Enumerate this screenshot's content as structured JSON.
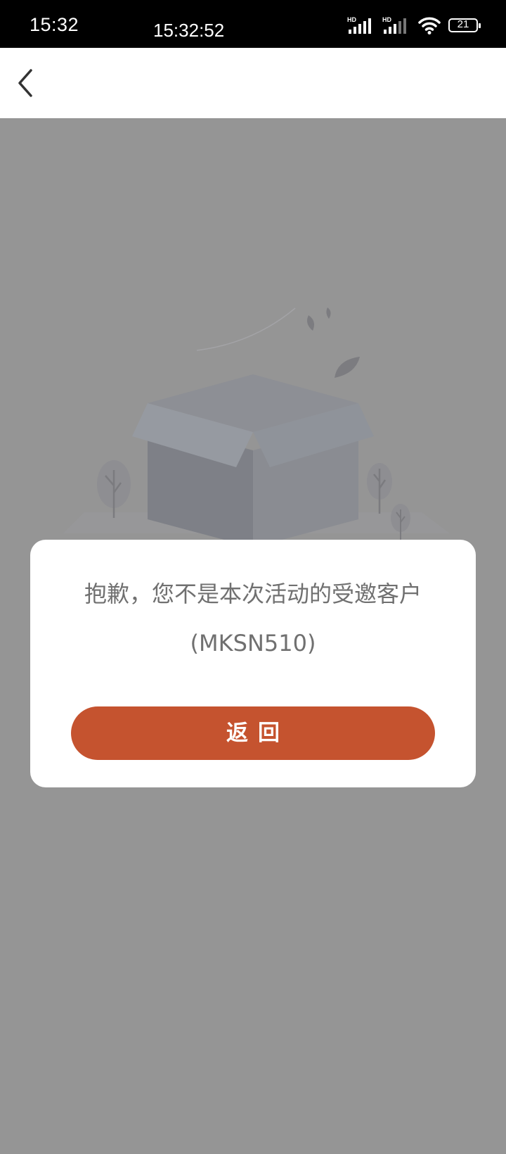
{
  "status_bar": {
    "time": "15:32",
    "clock": "15:32:52",
    "battery": "21"
  },
  "nav": {
    "back_icon": "chevron-left-icon"
  },
  "illustration": {
    "name": "empty-box-illustration"
  },
  "dialog": {
    "message_line1": "抱歉，您不是本次活动的受邀客户",
    "message_line2": "(MKSN510)",
    "button_label": "返回"
  },
  "colors": {
    "overlay": "#959595",
    "button": "#c5532f",
    "message_text": "#707070"
  }
}
